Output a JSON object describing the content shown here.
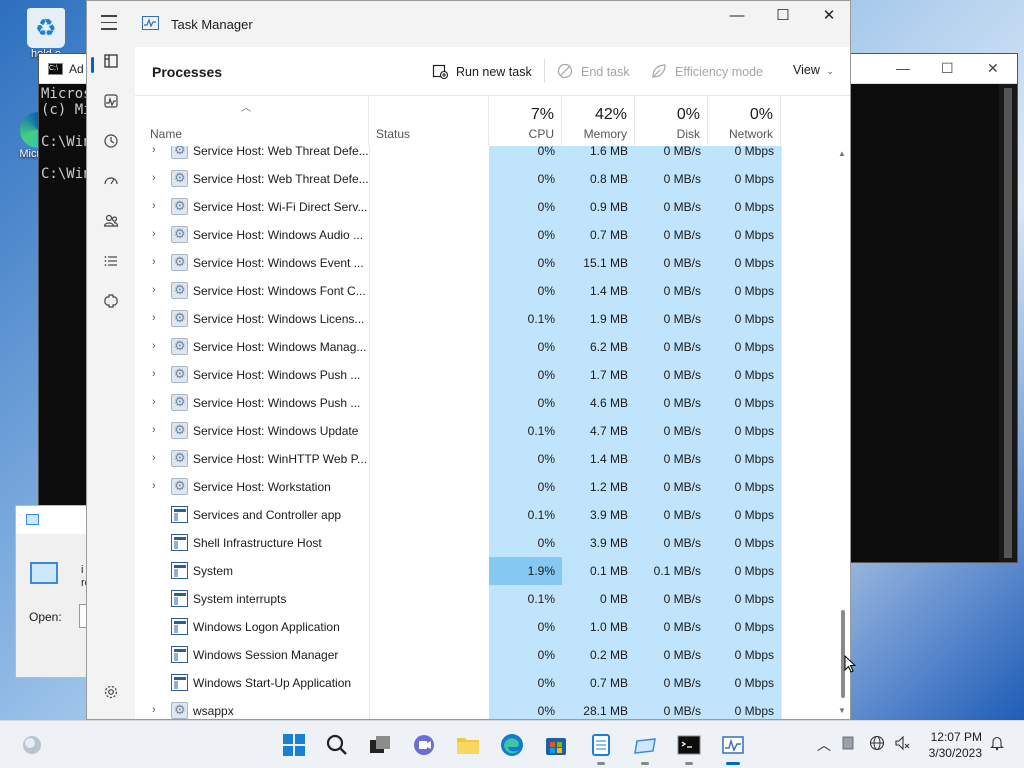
{
  "desktop": {
    "recycle_label": "hold o",
    "edge_label": "Micr Ed"
  },
  "console": {
    "title": "Ad",
    "lines": [
      "Micros",
      "(c) Mi",
      "",
      "C:\\Win",
      "",
      "C:\\Win"
    ]
  },
  "run_dialog": {
    "text": "i re",
    "open_label": "Open:"
  },
  "task_manager": {
    "title": "Task Manager",
    "page_title": "Processes",
    "commands": {
      "run_new_task": "Run new task",
      "end_task": "End task",
      "efficiency_mode": "Efficiency mode",
      "view": "View"
    },
    "columns": {
      "name": "Name",
      "status": "Status",
      "cpu": {
        "label": "CPU",
        "pct": "7%"
      },
      "memory": {
        "label": "Memory",
        "pct": "42%"
      },
      "disk": {
        "label": "Disk",
        "pct": "0%"
      },
      "network": {
        "label": "Network",
        "pct": "0%"
      }
    },
    "rows": [
      {
        "name": "Service Host: Web Threat Defe...",
        "icon": "gear",
        "expand": true,
        "cpu": "0%",
        "mem": "1.6 MB",
        "disk": "0 MB/s",
        "net": "0 Mbps"
      },
      {
        "name": "Service Host: Web Threat Defe...",
        "icon": "gear",
        "expand": true,
        "cpu": "0%",
        "mem": "0.8 MB",
        "disk": "0 MB/s",
        "net": "0 Mbps"
      },
      {
        "name": "Service Host: Wi-Fi Direct Serv...",
        "icon": "gear",
        "expand": true,
        "cpu": "0%",
        "mem": "0.9 MB",
        "disk": "0 MB/s",
        "net": "0 Mbps"
      },
      {
        "name": "Service Host: Windows Audio ...",
        "icon": "gear",
        "expand": true,
        "cpu": "0%",
        "mem": "0.7 MB",
        "disk": "0 MB/s",
        "net": "0 Mbps"
      },
      {
        "name": "Service Host: Windows Event ...",
        "icon": "gear",
        "expand": true,
        "cpu": "0%",
        "mem": "15.1 MB",
        "disk": "0 MB/s",
        "net": "0 Mbps"
      },
      {
        "name": "Service Host: Windows Font C...",
        "icon": "gear",
        "expand": true,
        "cpu": "0%",
        "mem": "1.4 MB",
        "disk": "0 MB/s",
        "net": "0 Mbps"
      },
      {
        "name": "Service Host: Windows Licens...",
        "icon": "gear",
        "expand": true,
        "cpu": "0.1%",
        "mem": "1.9 MB",
        "disk": "0 MB/s",
        "net": "0 Mbps"
      },
      {
        "name": "Service Host: Windows Manag...",
        "icon": "gear",
        "expand": true,
        "cpu": "0%",
        "mem": "6.2 MB",
        "disk": "0 MB/s",
        "net": "0 Mbps"
      },
      {
        "name": "Service Host: Windows Push ...",
        "icon": "gear",
        "expand": true,
        "cpu": "0%",
        "mem": "1.7 MB",
        "disk": "0 MB/s",
        "net": "0 Mbps"
      },
      {
        "name": "Service Host: Windows Push ...",
        "icon": "gear",
        "expand": true,
        "cpu": "0%",
        "mem": "4.6 MB",
        "disk": "0 MB/s",
        "net": "0 Mbps"
      },
      {
        "name": "Service Host: Windows Update",
        "icon": "gear",
        "expand": true,
        "cpu": "0.1%",
        "mem": "4.7 MB",
        "disk": "0 MB/s",
        "net": "0 Mbps"
      },
      {
        "name": "Service Host: WinHTTP Web P...",
        "icon": "gear",
        "expand": true,
        "cpu": "0%",
        "mem": "1.4 MB",
        "disk": "0 MB/s",
        "net": "0 Mbps"
      },
      {
        "name": "Service Host: Workstation",
        "icon": "gear",
        "expand": true,
        "cpu": "0%",
        "mem": "1.2 MB",
        "disk": "0 MB/s",
        "net": "0 Mbps"
      },
      {
        "name": "Services and Controller app",
        "icon": "win",
        "expand": false,
        "cpu": "0.1%",
        "mem": "3.9 MB",
        "disk": "0 MB/s",
        "net": "0 Mbps"
      },
      {
        "name": "Shell Infrastructure Host",
        "icon": "win",
        "expand": false,
        "cpu": "0%",
        "mem": "3.9 MB",
        "disk": "0 MB/s",
        "net": "0 Mbps"
      },
      {
        "name": "System",
        "icon": "win",
        "expand": false,
        "cpu": "1.9%",
        "mem": "0.1 MB",
        "disk": "0.1 MB/s",
        "net": "0 Mbps",
        "hot_cpu": true
      },
      {
        "name": "System interrupts",
        "icon": "win",
        "expand": false,
        "cpu": "0.1%",
        "mem": "0 MB",
        "disk": "0 MB/s",
        "net": "0 Mbps"
      },
      {
        "name": "Windows Logon Application",
        "icon": "win",
        "expand": false,
        "cpu": "0%",
        "mem": "1.0 MB",
        "disk": "0 MB/s",
        "net": "0 Mbps"
      },
      {
        "name": "Windows Session Manager",
        "icon": "win",
        "expand": false,
        "cpu": "0%",
        "mem": "0.2 MB",
        "disk": "0 MB/s",
        "net": "0 Mbps"
      },
      {
        "name": "Windows Start-Up Application",
        "icon": "win",
        "expand": false,
        "cpu": "0%",
        "mem": "0.7 MB",
        "disk": "0 MB/s",
        "net": "0 Mbps"
      },
      {
        "name": "wsappx",
        "icon": "gear",
        "expand": true,
        "cpu": "0%",
        "mem": "28.1 MB",
        "disk": "0 MB/s",
        "net": "0 Mbps"
      }
    ]
  },
  "taskbar": {
    "time": "12:07 PM",
    "date": "3/30/2023"
  },
  "colors": {
    "accent": "#0067c0",
    "heat_light": "#bfe4fb",
    "heat_medium": "#85c8f2"
  }
}
